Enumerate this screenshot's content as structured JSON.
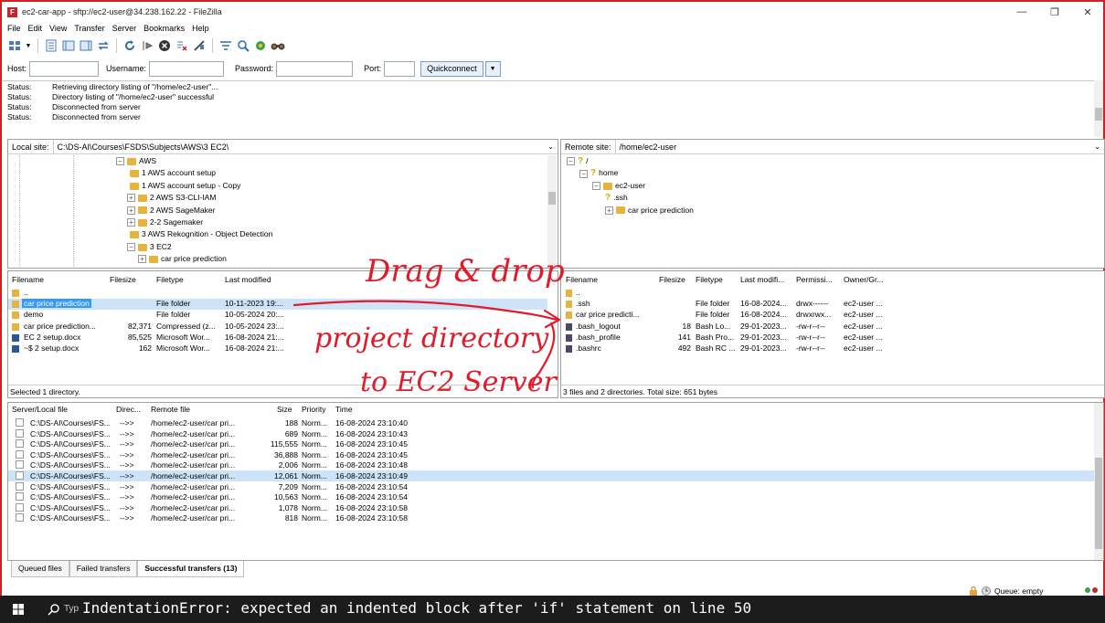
{
  "window": {
    "title": "ec2-car-app - sftp://ec2-user@34.238.162.22 - FileZilla",
    "app_icon_letter": "F",
    "controls": {
      "minimize": "—",
      "maximize": "❐",
      "close": "✕"
    }
  },
  "menu": [
    "File",
    "Edit",
    "View",
    "Transfer",
    "Server",
    "Bookmarks",
    "Help"
  ],
  "toolbar_icons": [
    "site-manager-icon",
    "dropdown-icon",
    "message-log-icon",
    "local-tree-icon",
    "remote-tree-icon",
    "transfer-queue-icon",
    "refresh-icon",
    "process-queue-icon",
    "cancel-icon",
    "cancel-queue-icon",
    "disconnect-icon",
    "filter-icon",
    "compare-icon",
    "sync-icon",
    "search-icon"
  ],
  "quickconnect": {
    "host_label": "Host:",
    "host_value": "",
    "username_label": "Username:",
    "username_value": "",
    "password_label": "Password:",
    "password_value": "",
    "port_label": "Port:",
    "port_value": "",
    "button": "Quickconnect",
    "dropdown": "▼"
  },
  "log": [
    {
      "k": "Status:",
      "v": "Retrieving directory listing of \"/home/ec2-user\"..."
    },
    {
      "k": "Status:",
      "v": "Directory listing of \"/home/ec2-user\" successful"
    },
    {
      "k": "Status:",
      "v": "Disconnected from server"
    },
    {
      "k": "Status:",
      "v": "Disconnected from server"
    }
  ],
  "local": {
    "site_label": "Local site:",
    "site_path": "C:\\DS-AI\\Courses\\FSDS\\Subjects\\AWS\\3 EC2\\",
    "tree": [
      {
        "label": "AWS",
        "depth": 0,
        "exp": "−"
      },
      {
        "label": "1 AWS account setup",
        "depth": 1,
        "exp": ""
      },
      {
        "label": "1 AWS account setup - Copy",
        "depth": 1,
        "exp": ""
      },
      {
        "label": "2 AWS S3-CLI-IAM",
        "depth": 1,
        "exp": "+"
      },
      {
        "label": "2 AWS SageMaker",
        "depth": 1,
        "exp": "+"
      },
      {
        "label": "2-2 Sagemaker",
        "depth": 1,
        "exp": "+"
      },
      {
        "label": "3 AWS Rekognition - Object Detection",
        "depth": 1,
        "exp": ""
      },
      {
        "label": "3 EC2",
        "depth": 1,
        "exp": "−"
      },
      {
        "label": "car price prediction",
        "depth": 2,
        "exp": "+"
      }
    ],
    "columns": [
      "Filename",
      "Filesize",
      "Filetype",
      "Last modified"
    ],
    "files": [
      {
        "name": "..",
        "size": "",
        "type": "",
        "modified": ""
      },
      {
        "name": "car price prediction",
        "size": "",
        "type": "File folder",
        "modified": "10-11-2023 19:..."
      },
      {
        "name": "demo",
        "size": "",
        "type": "File folder",
        "modified": "10-05-2024 20:..."
      },
      {
        "name": "car price prediction...",
        "size": "82,371",
        "type": "Compressed (z...",
        "modified": "10-05-2024 23:..."
      },
      {
        "name": "EC 2 setup.docx",
        "size": "85,525",
        "type": "Microsoft Wor...",
        "modified": "16-08-2024 21:..."
      },
      {
        "name": "~$ 2 setup.docx",
        "size": "162",
        "type": "Microsoft Wor...",
        "modified": "16-08-2024 21:..."
      }
    ],
    "status": "Selected 1 directory."
  },
  "remote": {
    "site_label": "Remote site:",
    "site_path": "/home/ec2-user",
    "tree": [
      {
        "label": "/",
        "depth": 0,
        "exp": "−"
      },
      {
        "label": "home",
        "depth": 1,
        "exp": "−"
      },
      {
        "label": "ec2-user",
        "depth": 2,
        "exp": "−"
      },
      {
        "label": ".ssh",
        "depth": 3,
        "exp": ""
      },
      {
        "label": "car price prediction",
        "depth": 3,
        "exp": "+"
      }
    ],
    "columns": [
      "Filename",
      "Filesize",
      "Filetype",
      "Last modifi...",
      "Permissi...",
      "Owner/Gr..."
    ],
    "files": [
      {
        "name": "..",
        "size": "",
        "type": "",
        "modified": "",
        "perm": "",
        "owner": ""
      },
      {
        "name": ".ssh",
        "size": "",
        "type": "File folder",
        "modified": "16-08-2024...",
        "perm": "drwx------",
        "owner": "ec2-user ..."
      },
      {
        "name": "car price predicti...",
        "size": "",
        "type": "File folder",
        "modified": "16-08-2024...",
        "perm": "drwxrwx...",
        "owner": "ec2-user ..."
      },
      {
        "name": ".bash_logout",
        "size": "18",
        "type": "Bash Lo...",
        "modified": "29-01-2023...",
        "perm": "-rw-r--r--",
        "owner": "ec2-user ..."
      },
      {
        "name": ".bash_profile",
        "size": "141",
        "type": "Bash Pro...",
        "modified": "29-01-2023...",
        "perm": "-rw-r--r--",
        "owner": "ec2-user ..."
      },
      {
        "name": ".bashrc",
        "size": "492",
        "type": "Bash RC ...",
        "modified": "29-01-2023...",
        "perm": "-rw-r--r--",
        "owner": "ec2-user ..."
      }
    ],
    "status": "3 files and 2 directories. Total size: 651 bytes"
  },
  "queue": {
    "columns": [
      "Server/Local file",
      "Direc...",
      "Remote file",
      "Size",
      "Priority",
      "Time"
    ],
    "rows": [
      {
        "local": "C:\\DS-AI\\Courses\\FS...",
        "dir": "-->>",
        "remote": "/home/ec2-user/car pri...",
        "size": "188",
        "prio": "Norm...",
        "time": "16-08-2024 23:10:40"
      },
      {
        "local": "C:\\DS-AI\\Courses\\FS...",
        "dir": "-->>",
        "remote": "/home/ec2-user/car pri...",
        "size": "689",
        "prio": "Norm...",
        "time": "16-08-2024 23:10:43"
      },
      {
        "local": "C:\\DS-AI\\Courses\\FS...",
        "dir": "-->>",
        "remote": "/home/ec2-user/car pri...",
        "size": "115,555",
        "prio": "Norm...",
        "time": "16-08-2024 23:10:45"
      },
      {
        "local": "C:\\DS-AI\\Courses\\FS...",
        "dir": "-->>",
        "remote": "/home/ec2-user/car pri...",
        "size": "36,888",
        "prio": "Norm...",
        "time": "16-08-2024 23:10:45"
      },
      {
        "local": "C:\\DS-AI\\Courses\\FS...",
        "dir": "-->>",
        "remote": "/home/ec2-user/car pri...",
        "size": "2,006",
        "prio": "Norm...",
        "time": "16-08-2024 23:10:48"
      },
      {
        "local": "C:\\DS-AI\\Courses\\FS...",
        "dir": "-->>",
        "remote": "/home/ec2-user/car pri...",
        "size": "12,061",
        "prio": "Norm...",
        "time": "16-08-2024 23:10:49"
      },
      {
        "local": "C:\\DS-AI\\Courses\\FS...",
        "dir": "-->>",
        "remote": "/home/ec2-user/car pri...",
        "size": "7,209",
        "prio": "Norm...",
        "time": "16-08-2024 23:10:54"
      },
      {
        "local": "C:\\DS-AI\\Courses\\FS...",
        "dir": "-->>",
        "remote": "/home/ec2-user/car pri...",
        "size": "10,563",
        "prio": "Norm...",
        "time": "16-08-2024 23:10:54"
      },
      {
        "local": "C:\\DS-AI\\Courses\\FS...",
        "dir": "-->>",
        "remote": "/home/ec2-user/car pri...",
        "size": "1,078",
        "prio": "Norm...",
        "time": "16-08-2024 23:10:58"
      },
      {
        "local": "C:\\DS-AI\\Courses\\FS...",
        "dir": "-->>",
        "remote": "/home/ec2-user/car pri...",
        "size": "818",
        "prio": "Norm...",
        "time": "16-08-2024 23:10:58"
      }
    ]
  },
  "tabs": [
    "Queued files",
    "Failed transfers",
    "Successful transfers (13)"
  ],
  "statusbar": {
    "queue": "Queue: empty"
  },
  "taskbar": {
    "search_stub": "Typ",
    "error": "IndentationError: expected an indented block after 'if' statement on line 50"
  },
  "handwriting": [
    "Drag & drop",
    "project directory",
    "to EC2 Server"
  ],
  "colors": {
    "accent": "#3399ff",
    "annotation": "#e01b2a",
    "window_border": "#d0211f"
  }
}
